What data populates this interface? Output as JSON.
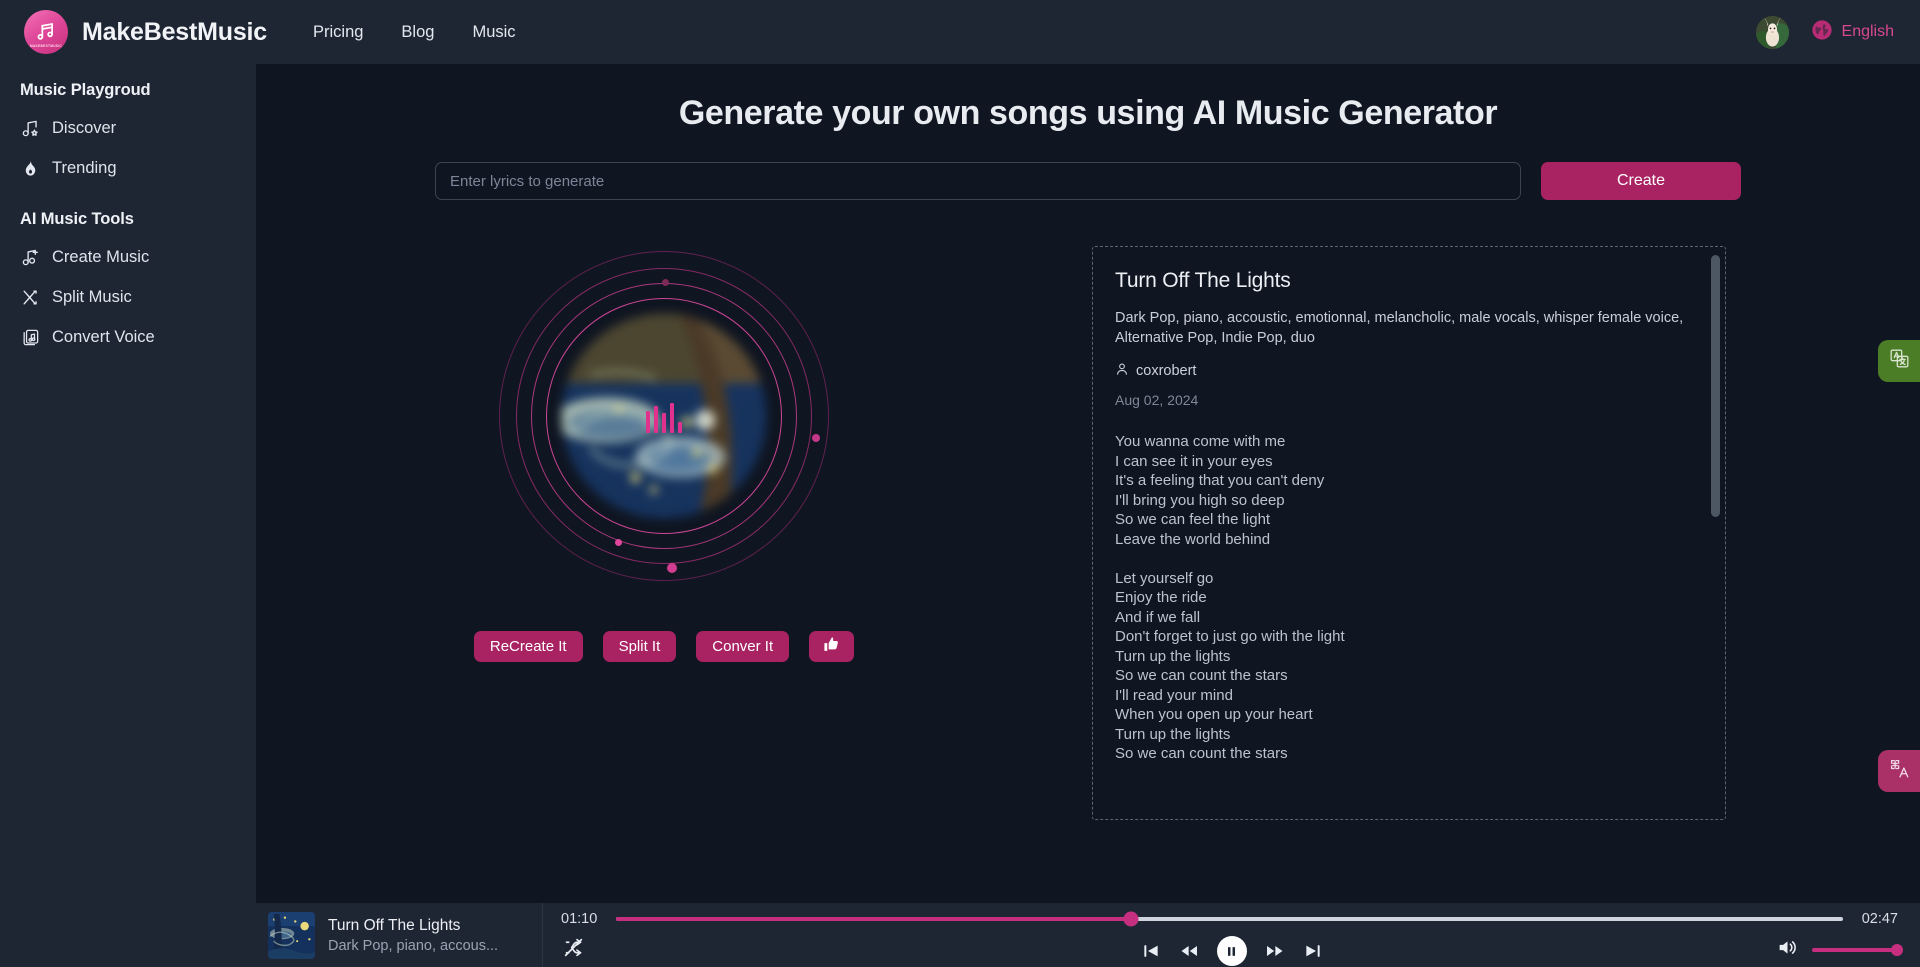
{
  "topbar": {
    "brand_name": "MakeBestMusic",
    "logo_micro_text": "MAKEBESTMUSIC",
    "nav_links": [
      {
        "label": "Pricing"
      },
      {
        "label": "Blog"
      },
      {
        "label": "Music"
      }
    ],
    "language_label": "English"
  },
  "sidebar": {
    "group1_title": "Music Playgroud",
    "group1_items": [
      {
        "label": "Discover",
        "icon": "music-note-star-icon"
      },
      {
        "label": "Trending",
        "icon": "flame-icon"
      }
    ],
    "group2_title": "AI Music Tools",
    "group2_items": [
      {
        "label": "Create Music",
        "icon": "music-note-plus-icon"
      },
      {
        "label": "Split Music",
        "icon": "split-branch-icon"
      },
      {
        "label": "Convert Voice",
        "icon": "voice-convert-icon"
      }
    ]
  },
  "main": {
    "heading": "Generate your own songs using AI Music Generator",
    "input_placeholder": "Enter lyrics to generate",
    "input_value": "",
    "create_label": "Create"
  },
  "actions": [
    {
      "label": "ReCreate It"
    },
    {
      "label": "Split It"
    },
    {
      "label": "Conver It"
    }
  ],
  "like_button": {
    "icon": "thumbs-up-icon"
  },
  "song": {
    "title": "Turn Off The Lights",
    "tags": "Dark Pop, piano, accoustic, emotionnal, melancholic, male vocals, whisper female voice, Alternative Pop, Indie Pop, duo",
    "author": "coxrobert",
    "date": "Aug 02, 2024",
    "lyrics": "You wanna come with me\nI can see it in your eyes\nIt's a feeling that you can't deny\nI'll bring you high so deep\nSo we can feel the light\nLeave the world behind\n\nLet yourself go\nEnjoy the ride\nAnd if we fall\nDon't forget to just go with the light\nTurn up the lights\nSo we can count the stars\nI'll read your mind\nWhen you open up your heart\nTurn up the lights\nSo we can count the stars"
  },
  "float_tabs": [
    {
      "name": "translate-green",
      "icon": "translate-icon",
      "color": "#4b7c26"
    },
    {
      "name": "translate-pink",
      "icon": "translate-cn-icon",
      "color": "#a93168"
    }
  ],
  "player": {
    "track_title": "Turn Off The Lights",
    "track_subtitle": "Dark Pop, piano, accous...",
    "current_time": "01:10",
    "total_time": "02:47",
    "progress_percent": 42,
    "volume_percent": 100,
    "shuffle_state": "off",
    "play_state": "playing",
    "controls": [
      {
        "name": "previous-track-button",
        "icon": "skip-back-icon"
      },
      {
        "name": "rewind-button",
        "icon": "rewind-icon"
      },
      {
        "name": "pause-button",
        "icon": "pause-icon"
      },
      {
        "name": "fast-forward-button",
        "icon": "fast-forward-icon"
      },
      {
        "name": "next-track-button",
        "icon": "skip-forward-icon"
      }
    ]
  },
  "colors": {
    "accent_pink": "#c62f7f",
    "button_pink": "#a92363",
    "panel_bg": "#1f2633",
    "main_bg": "#0f1521",
    "green_tab": "#4b7c26"
  }
}
